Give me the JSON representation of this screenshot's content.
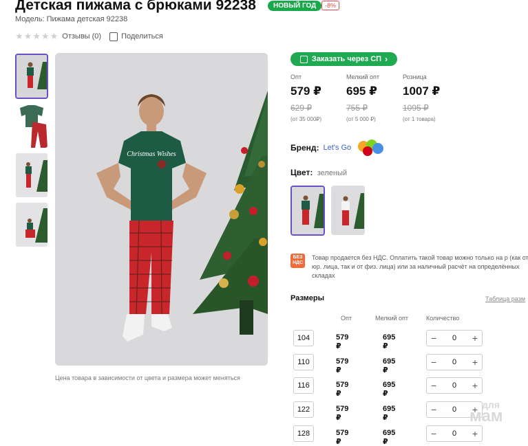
{
  "product": {
    "title": "Детская пижама с брюками 92238",
    "badge_new_year": "НОВЫЙ ГОД",
    "badge_discount": "-8%",
    "model": "Модель: Пижама детская 92238",
    "reviews": "Отзывы (0)",
    "share": "Поделиться",
    "price_note": "Цена товара в зависимости от цвета и размера может меняться"
  },
  "order_button": "Заказать через СП",
  "prices": [
    {
      "label": "Опт",
      "value": "579 ₽",
      "old": "629 ₽",
      "min": "(от 35 000₽)"
    },
    {
      "label": "Мелкий опт",
      "value": "695 ₽",
      "old": "755 ₽",
      "min": "(от 5 000 ₽)"
    },
    {
      "label": "Розница",
      "value": "1007 ₽",
      "old": "1095 ₽",
      "min": "(от 1 товара)"
    }
  ],
  "brand": {
    "label": "Бренд:",
    "name": "Let's Go"
  },
  "color": {
    "label": "Цвет:",
    "value": "зеленый"
  },
  "vat_icon": "БЕЗ НДС",
  "vat_text": "Товар продается без НДС. Оплатить такой товар можно только на р (как от юр. лица, так и от физ. лица) или за наличный расчёт на определённых складах",
  "sizes": {
    "title": "Размеры",
    "table_link": "Таблица разм",
    "headers": {
      "opt": "Опт",
      "small_opt": "Мелкий опт",
      "qty": "Количество"
    },
    "rows": [
      {
        "size": "104",
        "opt": "579 ₽",
        "small_opt": "695 ₽",
        "qty": "0"
      },
      {
        "size": "110",
        "opt": "579 ₽",
        "small_opt": "695 ₽",
        "qty": "0"
      },
      {
        "size": "116",
        "opt": "579 ₽",
        "small_opt": "695 ₽",
        "qty": "0"
      },
      {
        "size": "122",
        "opt": "579 ₽",
        "small_opt": "695 ₽",
        "qty": "0"
      },
      {
        "size": "128",
        "opt": "579 ₽",
        "small_opt": "695 ₽",
        "qty": "0"
      }
    ]
  },
  "watermark": {
    "top": "для",
    "bottom": "мам"
  },
  "logo_text": "Let's Go",
  "shirt_print": "Christmas Wishes",
  "colors": {
    "accent": "#1faa52",
    "selected_border": "#6b4ec9",
    "shirt": "#1e5b45",
    "pants": "#c8262a"
  }
}
